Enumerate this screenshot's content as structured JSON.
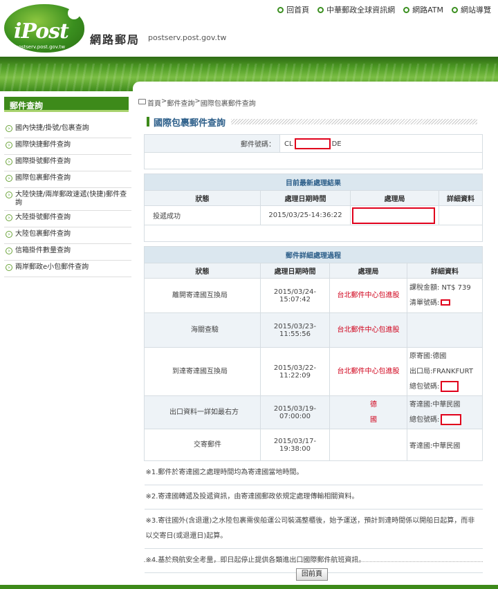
{
  "header": {
    "logo_text": "iPost",
    "logo_sub": "postserv.post.gov.tw",
    "site_title": "網路郵局",
    "site_domain": "postserv.post.gov.tw",
    "links": [
      "回首頁",
      "中華郵政全球資訊網",
      "網路ATM",
      "網站導覽"
    ]
  },
  "sidebar": {
    "heading": "郵件查詢",
    "items": [
      "國內快捷/掛號/包裹查詢",
      "國際快捷郵件查詢",
      "國際掛號郵件查詢",
      "國際包裹郵件查詢",
      "大陸快捷/兩岸郵政速遞(快捷)郵件查詢",
      "大陸掛號郵件查詢",
      "大陸包裹郵件查詢",
      "信箱掛件數量查詢",
      "兩岸郵政e小包郵件查詢"
    ]
  },
  "breadcrumb": {
    "home": "首頁",
    "sep": ">",
    "level1": "郵件查詢",
    "current": "國際包裹郵件查詢"
  },
  "page_title": "國際包裹郵件查詢",
  "tracking": {
    "label": "郵件號碼：",
    "prefix": "CL",
    "suffix": "DE"
  },
  "latest": {
    "heading": "目前最新處理結果",
    "columns": [
      "狀態",
      "處理日期時間",
      "處理局",
      "詳細資料"
    ],
    "status": "投遞成功",
    "datetime": "2015/03/25-14:36:22"
  },
  "history": {
    "heading": "郵件詳細處理過程",
    "columns": [
      "狀態",
      "處理日期時間",
      "處理局",
      "詳細資料"
    ],
    "rows": [
      {
        "status": "離開寄達國互換局",
        "datetime": "2015/03/24-15:07:42",
        "office": "台北郵件中心包進股",
        "detail1": "課稅金額: NT$ 739",
        "detail2": "清單號碼:"
      },
      {
        "status": "海關查驗",
        "datetime": "2015/03/23-11:55:56",
        "office": "台北郵件中心包進股",
        "detail1": "",
        "detail2": ""
      },
      {
        "status": "到達寄達國互換局",
        "datetime": "2015/03/22-11:22:09",
        "office": "台北郵件中心包進股",
        "detail1": "原寄國:德國",
        "detail2": "出口局:FRANKFURT",
        "detail3": "總包號碼:"
      },
      {
        "status": "出口資料一詳如最右方",
        "datetime": "2015/03/19-07:00:00",
        "office": "德國",
        "detail1": "寄達國:中華民國",
        "detail2": "總包號碼:"
      },
      {
        "status": "交寄郵件",
        "datetime": "2015/03/17-19:38:00",
        "office": "",
        "detail1": "寄達國:中華民國",
        "detail2": ""
      }
    ]
  },
  "notes": [
    "※1.郵件於寄達國之處理時間均為寄達國當地時間。",
    "※2.寄達國轉遞及投遞資訊，由寄達國郵政依規定處理傳輸相關資料。",
    "※3.寄往國外(含退還)之水陸包裹需俟船運公司裝滿整櫃後，始予運送，預計到達時間係以開船日起算，而非以交寄日(或退還日)起算。",
    "※4.基於飛航安全考量，即日起停止提供各類進出口國際郵件航班資訊。"
  ],
  "back_button": "回前頁",
  "colors": {
    "brand_green": "#3d8a1a",
    "title_blue": "#2d5f8a",
    "office_red": "#d0021b",
    "redact_red": "#e0001b"
  }
}
